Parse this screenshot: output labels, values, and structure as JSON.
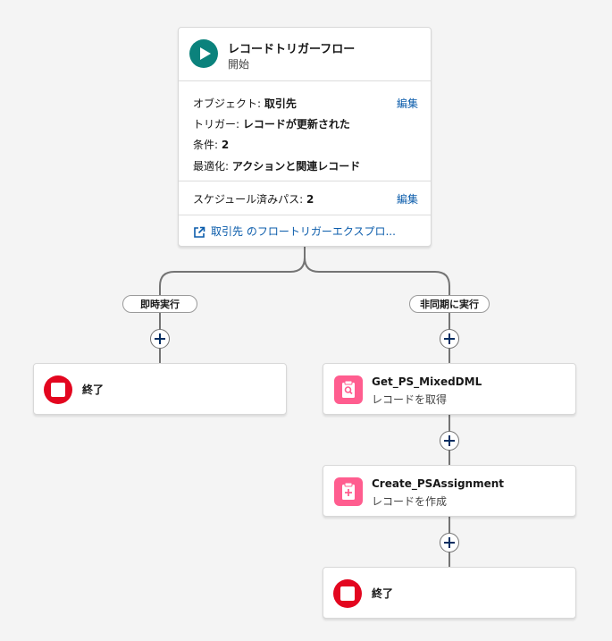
{
  "start": {
    "title": "レコードトリガーフロー",
    "subtitle": "開始",
    "object_label": "オブジェクト: ",
    "object_value": "取引先",
    "trigger_label": "トリガー: ",
    "trigger_value": "レコードが更新された",
    "conditions_label": "条件: ",
    "conditions_value": "2",
    "optimize_label": "最適化: ",
    "optimize_value": "アクションと関連レコード",
    "edit_label": "編集",
    "scheduled_label": "スケジュール済みパス: ",
    "scheduled_value": "2",
    "edit_label2": "編集",
    "explorer_link": "取引先 のフロートリガーエクスプロ..."
  },
  "paths": {
    "immediate": "即時実行",
    "async": "非同期に実行"
  },
  "nodes": {
    "end_left": "終了",
    "get_records": {
      "title": "Get_PS_MixedDML",
      "subtitle": "レコードを取得"
    },
    "create_records": {
      "title": "Create_PSAssignment",
      "subtitle": "レコードを作成"
    },
    "end_right": "終了"
  },
  "colors": {
    "start_icon": "#0b827c",
    "end_icon": "#e3061f",
    "record_icon": "#ff5d8f",
    "link": "#0b5cab"
  }
}
